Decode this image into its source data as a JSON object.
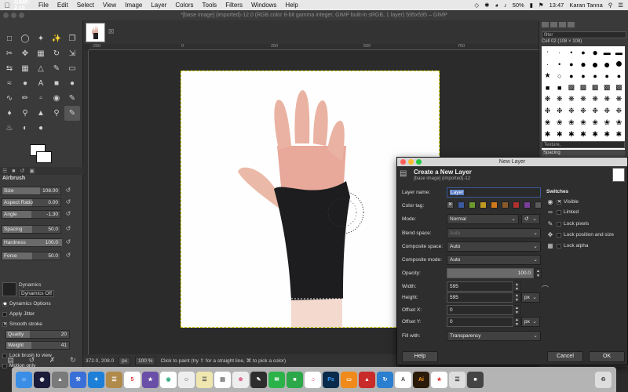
{
  "menubar": {
    "app_name": "GIMP-2.10",
    "items": [
      "File",
      "Edit",
      "Select",
      "View",
      "Image",
      "Layer",
      "Colors",
      "Tools",
      "Filters",
      "Windows",
      "Help"
    ],
    "battery": "50%",
    "clock": "13:47",
    "user": "Karan Tanna"
  },
  "window": {
    "title": "*[base image] (imported)-12.0 (RGB color 8-bit gamma integer, GIMP built-in sRGB, 1 layer) 595x595 – GIMP"
  },
  "toolbox": {
    "tools": [
      "rect-select",
      "ellipse-select",
      "free-select",
      "fuzzy-select",
      "crop",
      "move",
      "align",
      "scale",
      "rotate",
      "flip",
      "cage",
      "warp",
      "unified-transform",
      "perspective",
      "handle-transform",
      "text",
      "path",
      "color-picker",
      "measure",
      "zoom",
      "paintbrush",
      "pencil",
      "airbrush",
      "ink",
      "mypaint",
      "clone",
      "heal",
      "smudge",
      "dodge",
      "blur",
      "bucket-fill",
      "gradient",
      "eraser",
      "fuzzy-select-alt",
      "airbrush-active"
    ],
    "tool_options_title": "Airbrush",
    "sliders": [
      {
        "label": "Size",
        "value": "108.00"
      },
      {
        "label": "Aspect Ratio",
        "value": "0.00"
      },
      {
        "label": "Angle",
        "value": "-1.30"
      },
      {
        "label": "Spacing",
        "value": "50.0"
      },
      {
        "label": "Hardness",
        "value": "100.0"
      },
      {
        "label": "Force",
        "value": "50.0"
      }
    ],
    "dynamics_label": "Dynamics",
    "dynamics_value": "Dynamics Off",
    "dynamics_options": "Dynamics Options",
    "apply_jitter": "Apply Jitter",
    "smooth_stroke": "Smooth stroke",
    "quality": {
      "label": "Quality",
      "value": "20"
    },
    "weight": {
      "label": "Weight",
      "value": "41"
    },
    "lock_brush": "Lock brush to view",
    "motion_only": "Motion only"
  },
  "canvas": {
    "ruler_ticks": [
      "-250",
      "0",
      "250",
      "500",
      "750"
    ]
  },
  "statusbar": {
    "coords": "372.0, 208.0",
    "unit": "px",
    "zoom": "100 %",
    "hint": "Click to paint (try ⇧ for a straight line, ⌘ to pick a color)"
  },
  "brushes": {
    "filter": "filter",
    "current": "Cell 02 (108 × 108)",
    "tag": "Texture,",
    "spacing": "Spacing"
  },
  "dialog": {
    "title": "New Layer",
    "heading": "Create a New Layer",
    "subheading": "[base image] (imported)-12",
    "layer_name_label": "Layer name:",
    "layer_name": "Layer",
    "color_tag_label": "Color tag:",
    "mode_label": "Mode:",
    "mode": "Normal",
    "blend_space_label": "Blend space:",
    "blend_space": "Auto",
    "composite_space_label": "Composite space:",
    "composite_space": "Auto",
    "composite_mode_label": "Composite mode:",
    "composite_mode": "Auto",
    "opacity_label": "Opacity:",
    "opacity": "100.0",
    "width_label": "Width:",
    "width": "595",
    "height_label": "Height:",
    "height": "595",
    "offset_x_label": "Offset X:",
    "offset_x": "0",
    "offset_y_label": "Offset Y:",
    "offset_y": "0",
    "unit": "px",
    "fill_label": "Fill with:",
    "fill": "Transparency",
    "switches_title": "Switches",
    "visible": "Visible",
    "linked": "Linked",
    "lock_pixels": "Lock pixels",
    "lock_position": "Lock position and size",
    "lock_alpha": "Lock alpha",
    "help": "Help",
    "cancel": "Cancel",
    "ok": "OK",
    "tag_colors": [
      "#5a5a5a",
      "#3c5aa0",
      "#6f9a2f",
      "#bf9a22",
      "#d07a1a",
      "#8b5a2b",
      "#b03030",
      "#7a3f9a",
      "#5a5a5a"
    ]
  },
  "dock_apps": [
    "Finder",
    "Siri",
    "Launchpad",
    "Xcode",
    "Safari",
    "Notes",
    "Calendar",
    "Stickies",
    "Photos",
    "iMovie",
    "Chrome",
    "Contacts",
    "Reminders",
    "Preview",
    "iPhoto",
    "Messages",
    "FaceTime",
    "Maps",
    "iTunes",
    "Photoshop",
    "Books",
    "Acrobat",
    "Sync",
    "Illustrator",
    "Lightroom",
    "Notes2",
    "Trash"
  ],
  "accent": "#d8d800"
}
